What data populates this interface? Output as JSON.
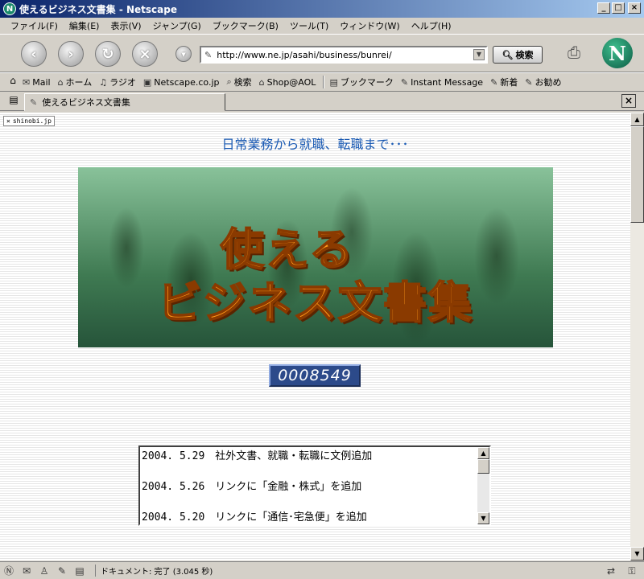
{
  "window": {
    "title": "使えるビジネス文書集 - Netscape",
    "minimize": "_",
    "maximize": "□",
    "close": "×"
  },
  "menu": [
    "ファイル(F)",
    "編集(E)",
    "表示(V)",
    "ジャンプ(G)",
    "ブックマーク(B)",
    "ツール(T)",
    "ウィンドウ(W)",
    "ヘルプ(H)"
  ],
  "navbar": {
    "url": "http://www.ne.jp/asahi/business/bunrei/",
    "search_label": "検索"
  },
  "personal_bar": {
    "items": [
      {
        "icon": "mail-icon",
        "label": "Mail"
      },
      {
        "icon": "home-icon",
        "label": "ホーム"
      },
      {
        "icon": "radio-icon",
        "label": "ラジオ"
      },
      {
        "icon": "my-netscape-icon",
        "label": "Netscape.co.jp"
      },
      {
        "icon": "search-icon",
        "label": "検索"
      },
      {
        "icon": "shop-icon",
        "label": "Shop@AOL"
      },
      {
        "icon": "bookmark-icon",
        "label": "ブックマーク"
      },
      {
        "icon": "link-icon",
        "label": "Instant Message"
      },
      {
        "icon": "link-icon",
        "label": "新着"
      },
      {
        "icon": "link-icon",
        "label": "お勧め"
      }
    ]
  },
  "tab": {
    "label": "使えるビジネス文書集"
  },
  "page": {
    "shinobi": "shinobi.jp",
    "headline": "日常業務から就職、転職まで･･･",
    "banner_line1": "使える",
    "banner_line2": "ビジネス文書集",
    "counter": "0008549",
    "news": [
      "2004. 5.29　社外文書、就職・転職に文例追加",
      "2004. 5.26　リンクに「金融・株式」を追加",
      "2004. 5.20　リンクに「通信･宅急便」を追加"
    ]
  },
  "status": {
    "text": "ドキュメント: 完了 (3.045 秒)"
  }
}
